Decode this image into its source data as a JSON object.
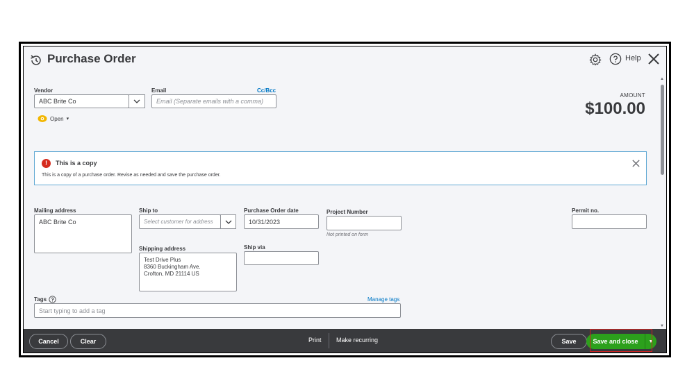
{
  "header": {
    "title": "Purchase Order",
    "help_label": "Help"
  },
  "vendor": {
    "label": "Vendor",
    "value": "ABC Brite Co"
  },
  "email": {
    "label": "Email",
    "placeholder": "Email (Separate emails with a comma)",
    "cc_bcc": "Cc/Bcc"
  },
  "status": {
    "label": "Open",
    "color": "#f2b600"
  },
  "amount": {
    "label": "AMOUNT",
    "value": "$100.00"
  },
  "banner": {
    "title": "This is a copy",
    "text": "This is a copy of a purchase order. Revise as needed and save the purchase order.",
    "border_color": "#5fa8d3",
    "icon_color": "#d52b1e"
  },
  "mailing_address": {
    "label": "Mailing address",
    "value": "ABC Brite Co"
  },
  "ship_to": {
    "label": "Ship to",
    "placeholder": "Select customer for address"
  },
  "shipping_address": {
    "label": "Shipping address",
    "line1": "Test Drive Plus",
    "line2": "8360 Buckingham Ave.",
    "line3": "Crofton, MD  21114 US"
  },
  "po_date": {
    "label": "Purchase Order date",
    "value": "10/31/2023"
  },
  "ship_via": {
    "label": "Ship via",
    "value": ""
  },
  "project_number": {
    "label": "Project Number",
    "value": "",
    "note": "Not printed on form"
  },
  "permit": {
    "label": "Permit no.",
    "value": ""
  },
  "tags": {
    "label": "Tags",
    "manage_link": "Manage tags",
    "placeholder": "Start typing to add a tag"
  },
  "footer": {
    "cancel": "Cancel",
    "clear": "Clear",
    "print": "Print",
    "make_recurring": "Make recurring",
    "save": "Save",
    "save_and_close": "Save and close",
    "accent_color": "#2ca01c",
    "background_color": "#393a3d"
  }
}
